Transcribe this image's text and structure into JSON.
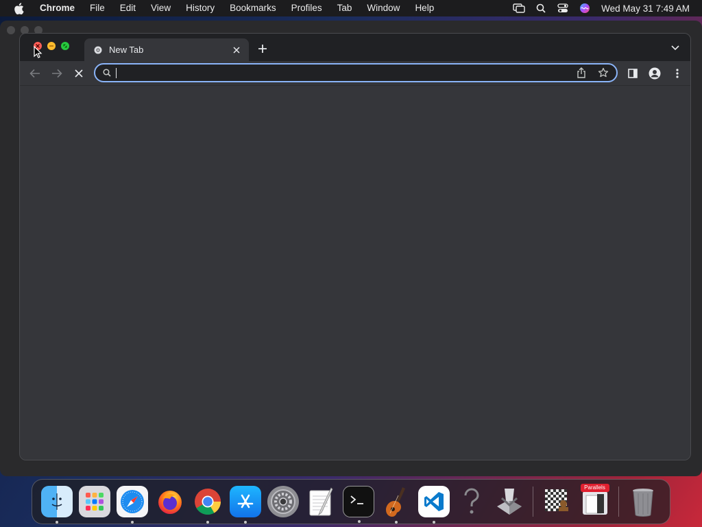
{
  "menubar": {
    "app_name": "Chrome",
    "items": [
      "File",
      "Edit",
      "View",
      "History",
      "Bookmarks",
      "Profiles",
      "Tab",
      "Window",
      "Help"
    ],
    "clock": "Wed May 31  7:49 AM",
    "icons": [
      "screen-mirroring-icon",
      "spotlight-search-icon",
      "control-center-icon",
      "siri-icon"
    ]
  },
  "browser": {
    "tab": {
      "title": "New Tab",
      "favicon": "chrome-favicon-icon"
    },
    "omnibox": {
      "value": "",
      "placeholder": ""
    },
    "accent": "#8ab4f8",
    "toolbar_icons": [
      "back-arrow-icon",
      "forward-arrow-icon",
      "stop-loading-icon",
      "share-icon",
      "bookmark-star-icon",
      "side-panel-icon",
      "profile-icon",
      "more-menu-icon"
    ]
  },
  "dock": {
    "apps": [
      {
        "name": "finder-icon",
        "running": true
      },
      {
        "name": "launchpad-icon",
        "running": false
      },
      {
        "name": "safari-icon",
        "running": true
      },
      {
        "name": "firefox-icon",
        "running": false
      },
      {
        "name": "chrome-icon",
        "running": true
      },
      {
        "name": "app-store-icon",
        "running": true
      },
      {
        "name": "system-settings-icon",
        "running": false
      },
      {
        "name": "textedit-icon",
        "running": false
      },
      {
        "name": "terminal-icon",
        "running": true
      },
      {
        "name": "garageband-icon",
        "running": true
      },
      {
        "name": "vscode-icon",
        "running": true
      },
      {
        "name": "help-icon",
        "running": false
      },
      {
        "name": "installer-icon",
        "running": false
      },
      {
        "name": "chess-icon",
        "running": false
      },
      {
        "name": "parallels-icon",
        "running": false,
        "badge": "Parallels"
      },
      {
        "name": "trash-icon",
        "running": false
      }
    ]
  }
}
